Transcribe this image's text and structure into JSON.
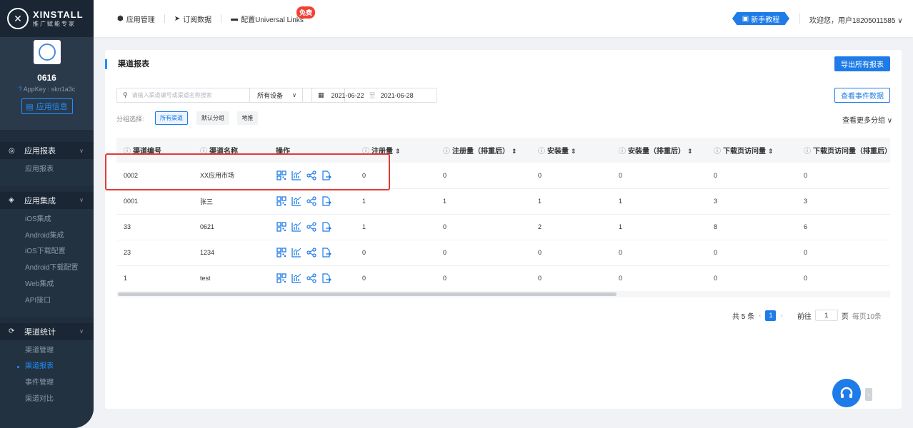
{
  "brand": {
    "name": "XINSTALL",
    "subtitle": "推广赋能专家"
  },
  "app": {
    "name": "0616",
    "appkey": "AppKey : skn1a3c",
    "info_button": "应用信息"
  },
  "sidebar": {
    "groups": [
      {
        "label": "应用报表",
        "items": [
          {
            "label": "应用报表",
            "active": false
          }
        ]
      },
      {
        "label": "应用集成",
        "items": [
          {
            "label": "iOS集成",
            "active": false
          },
          {
            "label": "Android集成",
            "active": false
          },
          {
            "label": "iOS下载配置",
            "active": false
          },
          {
            "label": "Android下载配置",
            "active": false
          },
          {
            "label": "Web集成",
            "active": false
          },
          {
            "label": "API接口",
            "active": false
          }
        ]
      },
      {
        "label": "渠道统计",
        "items": [
          {
            "label": "渠道管理",
            "active": false
          },
          {
            "label": "渠道报表",
            "active": true
          },
          {
            "label": "事件管理",
            "active": false
          },
          {
            "label": "渠道对比",
            "active": false
          }
        ]
      }
    ]
  },
  "topbar": {
    "items": [
      "应用管理",
      "订阅数据",
      "配置Universal Links"
    ],
    "free_badge": "免费",
    "guide": "新手教程",
    "welcome": "欢迎您，用户18205011585"
  },
  "panel": {
    "title": "渠道报表",
    "export_all": "导出所有报表",
    "view_events": "查看事件数据",
    "search_placeholder": "请输入渠道编号或渠道名称搜索",
    "device": "所有设备",
    "date_start": "2021-06-22",
    "date_sep": "至",
    "date_end": "2021-06-28",
    "group_label": "分组选择:",
    "groups": [
      "所有渠道",
      "默认分组",
      "地推"
    ],
    "more_groups": "查看更多分组"
  },
  "table": {
    "columns": [
      "渠道编号",
      "渠道名称",
      "操作",
      "注册量",
      "注册量（排重后）",
      "安装量",
      "安装量（排重后）",
      "下载页访问量",
      "下载页访问量（排重后）"
    ],
    "rows": [
      {
        "id": "0002",
        "name": "XX应用市场",
        "reg": "0",
        "reg_u": "0",
        "inst": "0",
        "inst_u": "0",
        "visit": "0",
        "visit_u": "0"
      },
      {
        "id": "0001",
        "name": "张三",
        "reg": "1",
        "reg_u": "1",
        "inst": "1",
        "inst_u": "1",
        "visit": "3",
        "visit_u": "3"
      },
      {
        "id": "33",
        "name": "0621",
        "reg": "1",
        "reg_u": "0",
        "inst": "2",
        "inst_u": "1",
        "visit": "8",
        "visit_u": "6"
      },
      {
        "id": "23",
        "name": "1234",
        "reg": "0",
        "reg_u": "0",
        "inst": "0",
        "inst_u": "0",
        "visit": "0",
        "visit_u": "0"
      },
      {
        "id": "1",
        "name": "test",
        "reg": "0",
        "reg_u": "0",
        "inst": "0",
        "inst_u": "0",
        "visit": "0",
        "visit_u": "0"
      }
    ]
  },
  "pager": {
    "total": "共 5 条",
    "current": "1",
    "goto_label": "前往",
    "goto_value": "1",
    "page_unit": "页",
    "per_page": "每页10条"
  },
  "colors": {
    "accent": "#1e7be8",
    "sidebar_bg": "#1f2d3d",
    "highlight": "#e53935",
    "badge": "#f04134"
  }
}
